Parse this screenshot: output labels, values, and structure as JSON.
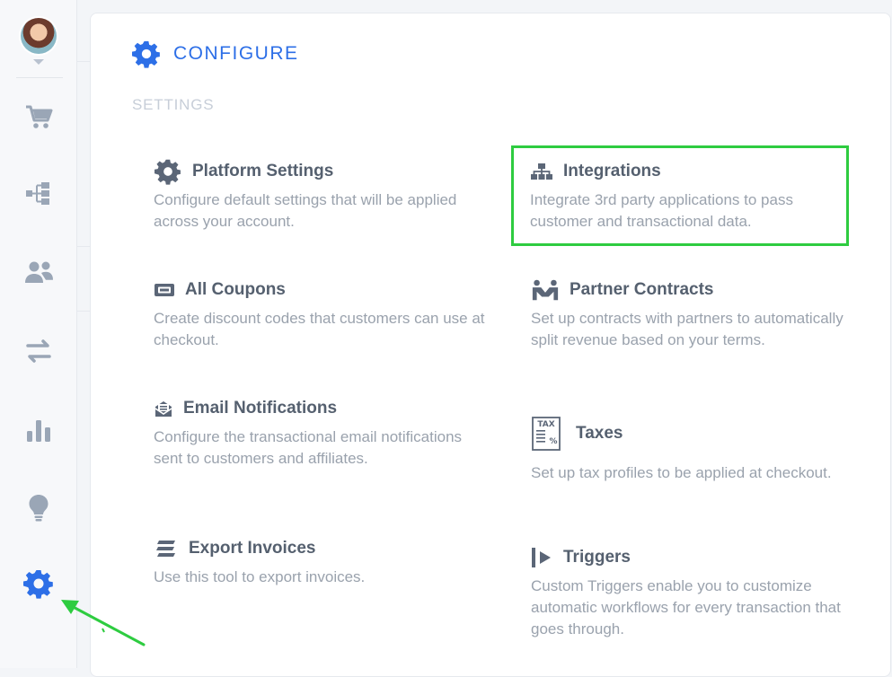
{
  "sidebar": {
    "avatar_alt": "",
    "items": [
      {
        "name": "cart",
        "icon": "shopping-cart-icon"
      },
      {
        "name": "funnel",
        "icon": "sitemap-flow-icon"
      },
      {
        "name": "users",
        "icon": "users-icon"
      },
      {
        "name": "transfers",
        "icon": "exchange-arrows-icon"
      },
      {
        "name": "reports",
        "icon": "bar-chart-icon"
      },
      {
        "name": "ideas",
        "icon": "lightbulb-icon"
      },
      {
        "name": "configure",
        "icon": "gear-icon",
        "active": true
      }
    ]
  },
  "header": {
    "title": "CONFIGURE"
  },
  "section": {
    "label": "SETTINGS"
  },
  "cards": {
    "platform_settings": {
      "title": "Platform Settings",
      "desc": "Configure default settings that will be applied across your account."
    },
    "integrations": {
      "title": "Integrations",
      "desc": "Integrate 3rd party applications to pass customer and transactional data."
    },
    "all_coupons": {
      "title": "All Coupons",
      "desc": "Create discount codes that customers can use at checkout."
    },
    "partner_contracts": {
      "title": "Partner Contracts",
      "desc": "Set up contracts with partners to automatically split revenue based on your terms."
    },
    "email_notifications": {
      "title": "Email Notifications",
      "desc": "Configure the transactional email notifications sent to customers and affiliates."
    },
    "taxes": {
      "title": "Taxes",
      "desc": "Set up tax profiles to be applied at checkout.",
      "icon_label": "TAX"
    },
    "export_invoices": {
      "title": "Export Invoices",
      "desc": "Use this tool to export invoices."
    },
    "triggers": {
      "title": "Triggers",
      "desc": "Custom Triggers enable you to customize automatic workflows for every transaction that goes through."
    }
  },
  "colors": {
    "accent": "#2d6fe7",
    "highlight": "#2ecc40",
    "title_text": "#55606f",
    "desc_text": "#9aa2ad",
    "nav_icon": "#9aa6b6"
  }
}
